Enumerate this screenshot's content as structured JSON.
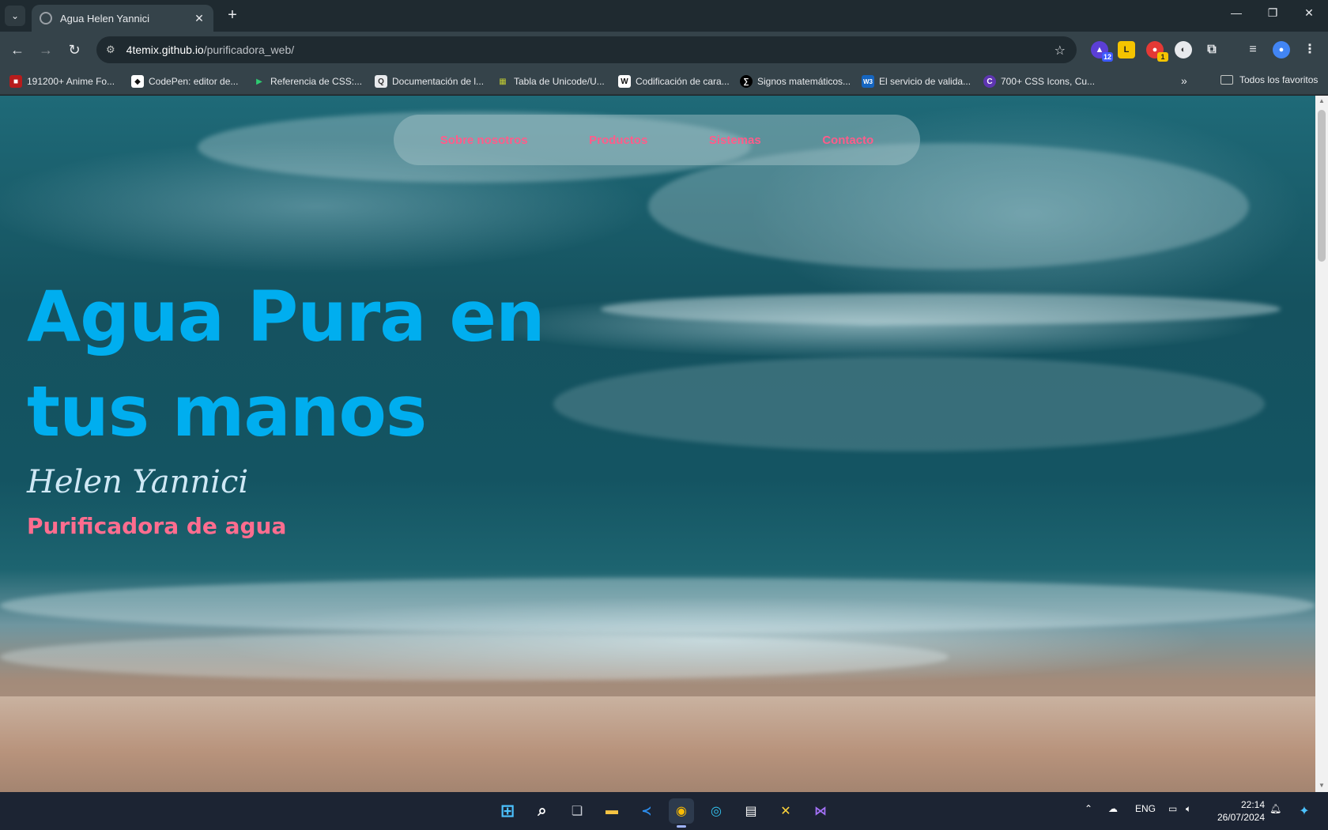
{
  "browser": {
    "tab": {
      "title": "Agua Helen Yannici",
      "close": "✕"
    },
    "new_tab": "+",
    "window": {
      "minimize": "—",
      "restore": "❐",
      "close": "✕"
    },
    "url": {
      "host": "4temix.github.io",
      "path": "/purificadora_web/"
    },
    "extensions": [
      {
        "name": "ext-cap-icon",
        "badge": "12",
        "color": "#5b3fd6"
      },
      {
        "name": "ext-note-icon",
        "badge": "",
        "color": "#f5c400"
      },
      {
        "name": "ext-record-icon",
        "badge": "1",
        "color": "#e53935"
      },
      {
        "name": "ext-circle-icon",
        "badge": "",
        "color": "#e8eaed"
      }
    ],
    "bookmarks": [
      {
        "label": "191200+ Anime Fo...",
        "icon_color": "#b71c1c",
        "glyph": "■"
      },
      {
        "label": "CodePen: editor de...",
        "icon_color": "#ffffff",
        "glyph": "◆"
      },
      {
        "label": "Referencia de CSS:...",
        "icon_color": "#2ecc71",
        "glyph": "▶"
      },
      {
        "label": "Documentación de l...",
        "icon_color": "#e8eaed",
        "glyph": "Q"
      },
      {
        "label": "Tabla de Unicode/U...",
        "icon_color": "#c0ca33",
        "glyph": "▦"
      },
      {
        "label": "Codificación de cara...",
        "icon_color": "#ffffff",
        "glyph": "W"
      },
      {
        "label": "Signos matemáticos...",
        "icon_color": "#000000",
        "glyph": "∑"
      },
      {
        "label": "El servicio de valida...",
        "icon_color": "#1565c0",
        "glyph": "W3"
      },
      {
        "label": "700+ CSS Icons, Cu...",
        "icon_color": "#5e35b1",
        "glyph": "C"
      }
    ],
    "bookmarks_overflow": "»",
    "favorites_folder": "Todos los favoritos"
  },
  "page": {
    "nav": [
      "Sobre nosotros",
      "Productos",
      "Sistemas",
      "Contacto"
    ],
    "hero": {
      "title_line1": "Agua Pura en",
      "title_line2": "tus manos",
      "name": "Helen Yannici",
      "subtitle": "Purificadora de agua"
    },
    "accent": "#00aeef",
    "link_color": "#ff5c8a"
  },
  "taskbar": {
    "language": "ENG",
    "time": "22:14",
    "date": "26/07/2024"
  }
}
